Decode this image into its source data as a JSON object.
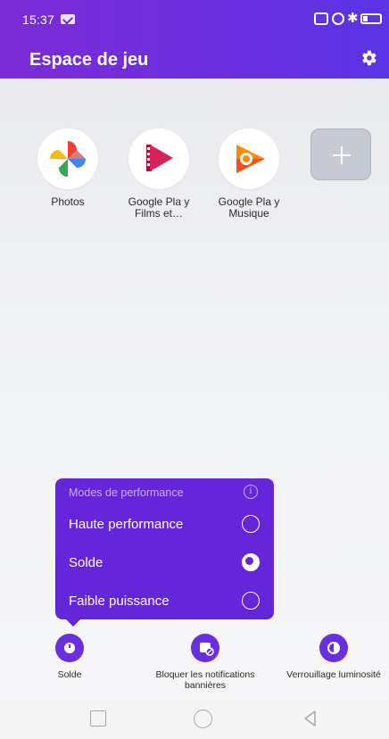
{
  "status_bar": {
    "time": "15:37",
    "icons": [
      "message-icon",
      "vibrate-icon",
      "nfc-icon",
      "bluetooth-icon",
      "battery-icon"
    ]
  },
  "header": {
    "title": "Espace de jeu",
    "settings_icon": "gear-icon"
  },
  "apps": [
    {
      "label": "Photos",
      "icon": "google-photos-icon"
    },
    {
      "label": "Google Pla y Films et…",
      "icon": "google-play-films-icon"
    },
    {
      "label": "Google Pla y Musique",
      "icon": "google-play-music-icon"
    }
  ],
  "add_app": {
    "icon": "plus-icon"
  },
  "performance_popup": {
    "title": "Modes de performance",
    "info_icon": "info-icon",
    "options": [
      {
        "label": "Haute performance",
        "selected": false
      },
      {
        "label": "Solde",
        "selected": true
      },
      {
        "label": "Faible puissance",
        "selected": false
      }
    ]
  },
  "quick_actions": [
    {
      "label": "Solde",
      "icon": "gauge-icon"
    },
    {
      "label": "Bloquer les notifications bannières",
      "icon": "block-notifications-icon"
    },
    {
      "label": "Verrouillage luminosité",
      "icon": "brightness-lock-icon"
    }
  ],
  "nav_bar": [
    "recents-square-icon",
    "home-circle-icon",
    "back-triangle-icon"
  ],
  "colors": {
    "header": "#6a2fe0",
    "accent": "#6526d9",
    "background": "#ecedf0"
  }
}
